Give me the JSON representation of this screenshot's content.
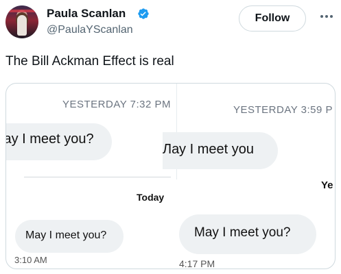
{
  "author": {
    "display_name": "Paula Scanlan",
    "handle": "@PaulaYScanlan",
    "verified": true
  },
  "follow_label": "Follow",
  "tweet_text": "The Bill Ackman Effect is real",
  "screenshot": {
    "left_header": "YESTERDAY 7:32 PM",
    "left_bubble_1": "lay I meet you?",
    "today_label": "Today",
    "left_bubble_2": "May I meet you?",
    "left_time": "3:10 AM",
    "right_header": "YESTERDAY 3:59 P",
    "right_bubble_1": "Лау I meet you",
    "right_side_label": "Ye",
    "right_bubble_2": "May I meet you?",
    "right_time": "4:17 PM"
  },
  "colors": {
    "verified_blue": "#1d9bf0",
    "bubble_gray": "#eef1f3"
  }
}
